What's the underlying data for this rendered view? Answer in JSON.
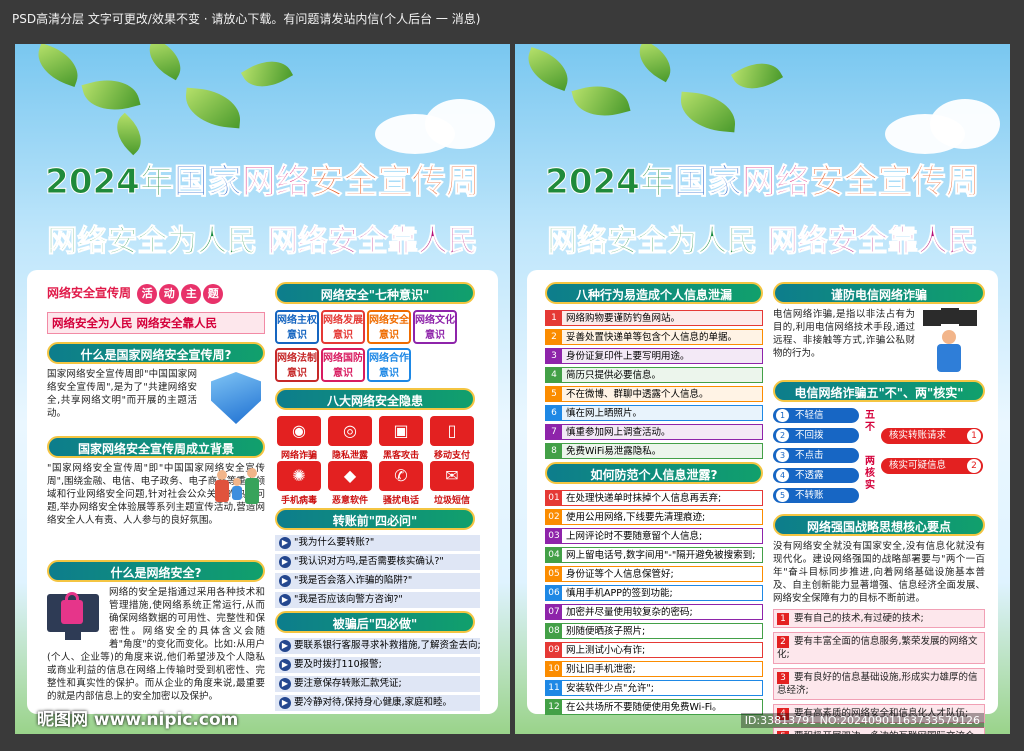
{
  "top_bar": "PSD高清分层 文字可更改/效果不变 · 请放心下载。有问题请发站内信(个人后台 一 消息)",
  "title": {
    "year": "2024年",
    "a": "国家",
    "b": "网络",
    "c": "安全宣传周"
  },
  "subtitle": {
    "left": "网络安全为人民",
    "right": "网络安全靠人民"
  },
  "left": {
    "tag": "网络安全宣传周",
    "circles": [
      "活",
      "动",
      "主",
      "题"
    ],
    "slogan": "网络安全为人民 网络安全靠人民",
    "h1": "什么是国家网络安全宣传周?",
    "p1": "国家网络安全宣传周即\"中国国家网络安全宣传周\",是为了\"共建网络安全,共享网络文明\"而开展的主题活动。",
    "h2": "国家网络安全宣传周成立背景",
    "p2": "\"国家网络安全宣传周\"即\"中国国家网络安全宣传周\",围绕金融、电信、电子政务、电子商务等重点领域和行业网络安全问题,针对社会公众关注的热点问题,举办网络安全体验展等系列主题宣传活动,营造网络安全人人有责、人人参与的良好氛围。",
    "h3": "什么是网络安全?",
    "p3": "网络的安全是指通过采用各种技术和管理措施,使网络系统正常运行,从而确保网络数据的可用性、完整性和保密性。网络安全的具体含义会随着\"角度\"的变化而变化。比如:从用户(个人、企业等)的角度来说,他们希望涉及个人隐私或商业利益的信息在网络上传输时受到机密性、完整性和真实性的保护。而从企业的角度来说,最重要的就是内部信息上的安全加密以及保护。",
    "seven_title": "网络安全\"七种意识\"",
    "seven": [
      {
        "t": "网络主权意识",
        "c": "#1565c0"
      },
      {
        "t": "网络发展意识",
        "c": "#e53935"
      },
      {
        "t": "网络安全意识",
        "c": "#ef6c00"
      },
      {
        "t": "网络文化意识",
        "c": "#8e24aa"
      },
      {
        "t": "网络法制意识",
        "c": "#c62828"
      },
      {
        "t": "网络国防意识",
        "c": "#d81b60"
      },
      {
        "t": "网络合作意识",
        "c": "#1e88e5"
      }
    ],
    "eight_title": "八大网络安全隐患",
    "eight": [
      {
        "label": "网络诈骗",
        "icon": "mask-icon",
        "glyph": "◉"
      },
      {
        "label": "隐私泄露",
        "icon": "eye-off-icon",
        "glyph": "◎"
      },
      {
        "label": "黑客攻击",
        "icon": "hacker-icon",
        "glyph": "▣"
      },
      {
        "label": "移动支付",
        "icon": "mobile-pay-icon",
        "glyph": "▯"
      },
      {
        "label": "手机病毒",
        "icon": "virus-icon",
        "glyph": "✺"
      },
      {
        "label": "恶意软件",
        "icon": "malware-icon",
        "glyph": "◆"
      },
      {
        "label": "骚扰电话",
        "icon": "phone-icon",
        "glyph": "✆"
      },
      {
        "label": "垃圾短信",
        "icon": "sms-icon",
        "glyph": "✉"
      }
    ],
    "four_ask_title": "转账前\"四必问\"",
    "four_ask": [
      "\"我为什么要转账?\"",
      "\"我认识对方吗,是否需要核实确认?\"",
      "\"我是否会落入诈骗的陷阱?\"",
      "\"我是否应该向警方咨询?\""
    ],
    "four_do_title": "被骗后\"四必做\"",
    "four_do": [
      "要联系银行客服寻求补救措施,了解资金去向;",
      "要及时拨打110报警;",
      "要注意保存转账汇款凭证;",
      "要冷静对待,保持身心健康,家庭和睦。"
    ]
  },
  "right": {
    "leak_title": "八种行为易造成个人信息泄漏",
    "leaks": [
      {
        "t": "网络购物要谨防钓鱼网站。",
        "c": "#e53935"
      },
      {
        "t": "妥善处置快递单等包含个人信息的单据。",
        "c": "#fb8c00"
      },
      {
        "t": "身份证复印件上要写明用途。",
        "c": "#8e24aa"
      },
      {
        "t": "简历只提供必要信息。",
        "c": "#43a047"
      },
      {
        "t": "不在微博、群聊中透露个人信息。",
        "c": "#fb8c00"
      },
      {
        "t": "慎在网上晒照片。",
        "c": "#1e88e5"
      },
      {
        "t": "慎重参加网上调查活动。",
        "c": "#8e24aa"
      },
      {
        "t": "免费WiFi易泄露隐私。",
        "c": "#43a047"
      }
    ],
    "prevent_title": "如何防范个人信息泄露?",
    "prevents": [
      {
        "t": "在处理快递单时抹掉个人信息再丢弃;",
        "c": "#e53935"
      },
      {
        "t": "使用公用网络,下线要先清理痕迹;",
        "c": "#fb8c00"
      },
      {
        "t": "上网评论时不要随意留个人信息;",
        "c": "#8e24aa"
      },
      {
        "t": "网上留电话号,数字间用\"-\"隔开避免被搜索到;",
        "c": "#43a047"
      },
      {
        "t": "身份证等个人信息保管好;",
        "c": "#fb8c00"
      },
      {
        "t": "慎用手机APP的签到功能;",
        "c": "#1e88e5"
      },
      {
        "t": "加密并尽量使用较复杂的密码;",
        "c": "#8e24aa"
      },
      {
        "t": "别随便晒孩子照片;",
        "c": "#43a047"
      },
      {
        "t": "网上测试小心有诈;",
        "c": "#e53935"
      },
      {
        "t": "别让旧手机泄密;",
        "c": "#fb8c00"
      },
      {
        "t": "安装软件少点\"允许\";",
        "c": "#1e88e5"
      },
      {
        "t": "在公共场所不要随便使用免费Wi-Fi。",
        "c": "#43a047"
      }
    ],
    "fraud_title": "谨防电信网络诈骗",
    "fraud_p": "电信网络诈骗,是指以非法占有为目的,利用电信网络技术手段,通过远程、非接触等方式,诈骗公私财物的行为。",
    "five_title": "电信网络诈骗五\"不\"、两\"核实\"",
    "five": [
      "不轻信",
      "不回拨",
      "不点击",
      "不透露",
      "不转账"
    ],
    "five_mid": "五不",
    "two_mid": "两核实",
    "two": [
      {
        "t": "核实转账请求",
        "n": "1"
      },
      {
        "t": "核实可疑信息",
        "n": "2"
      }
    ],
    "strong_title": "网络强国战略思想核心要点",
    "strong_p": "没有网络安全就没有国家安全,没有信息化就没有现代化。建设网络强国的战略部署要与\"两个一百年\"奋斗目标同步推进,向着网络基础设施基本普及、自主创新能力显著增强、信息经济全面发展、网络安全保障有力的目标不断前进。",
    "reqs": [
      "要有自己的技术,有过硬的技术;",
      "要有丰富全面的信息服务,繁荣发展的网络文化;",
      "要有良好的信息基础设施,形成实力雄厚的信息经济;",
      "要有高素质的网络安全和信息化人才队伍;",
      "要积极开展双边、多边的互联网国际交流合作。"
    ]
  },
  "watermark_left": "昵图网 www.nipic.com",
  "watermark_right": "ID:33813791 NO:20240901163733579126"
}
